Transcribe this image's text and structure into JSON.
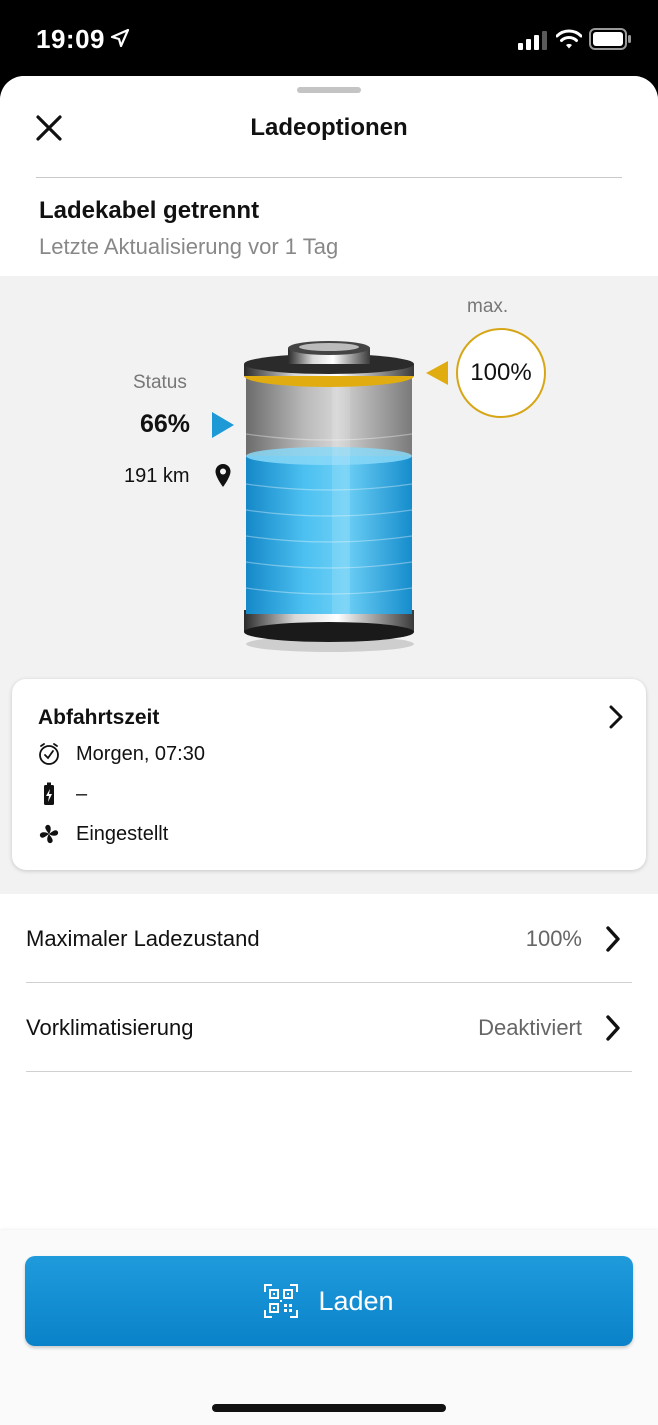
{
  "status_bar": {
    "time": "19:09"
  },
  "sheet": {
    "title": "Ladeoptionen",
    "cable_status": "Ladekabel getrennt",
    "last_update": "Letzte Aktualisierung vor 1 Tag"
  },
  "battery": {
    "max_label": "max.",
    "max_value": "100%",
    "status_label": "Status",
    "status_value": "66%",
    "charge_level": 0.66,
    "range": "191 km",
    "colors": {
      "fill": "#2ea8e0",
      "max_accent": "#e0ac10",
      "status_accent": "#1d9ad6"
    }
  },
  "departure": {
    "title": "Abfahrtszeit",
    "time": "Morgen, 07:30",
    "charge": "–",
    "climate": "Eingestellt"
  },
  "settings": [
    {
      "label": "Maximaler Ladezustand",
      "value": "100%"
    },
    {
      "label": "Vorklimatisierung",
      "value": "Deaktiviert"
    }
  ],
  "action": {
    "label": "Laden",
    "color": "#1491d6"
  }
}
